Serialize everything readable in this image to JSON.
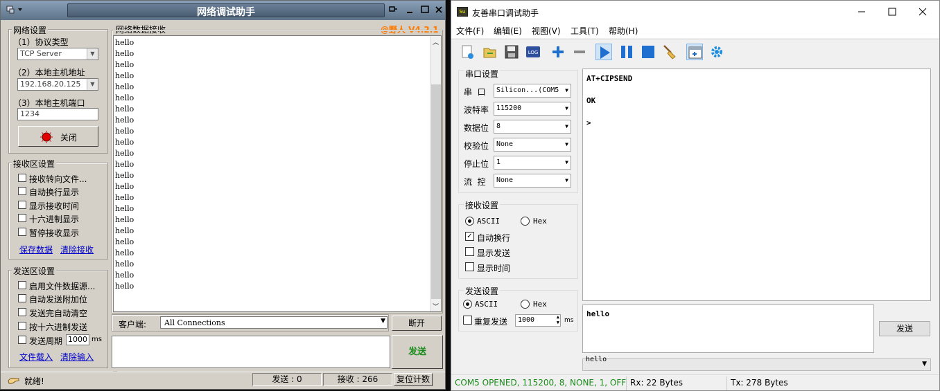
{
  "net": {
    "title": "网络调试助手",
    "version": "@野人 V4.2.1",
    "net_settings": {
      "group_label": "网络设置",
      "protocol_label": "（1）协议类型",
      "protocol_value": "TCP Server",
      "host_label": "（2）本地主机地址",
      "host_value": "192.168.20.125",
      "port_label": "（3）本地主机端口",
      "port_value": "1234",
      "close_button": "关闭"
    },
    "recv_settings": {
      "group_label": "接收区设置",
      "options": [
        "接收转向文件...",
        "自动换行显示",
        "显示接收时间",
        "十六进制显示",
        "暂停接收显示"
      ],
      "save_link": "保存数据",
      "clear_link": "清除接收"
    },
    "send_settings": {
      "group_label": "发送区设置",
      "options": [
        "启用文件数据源...",
        "自动发送附加位",
        "发送完自动清空",
        "按十六进制发送"
      ],
      "period_label": "发送周期",
      "period_value": "1000",
      "period_unit": "ms",
      "load_link": "文件载入",
      "clear_link": "清除输入"
    },
    "recv_area_label": "网络数据接收",
    "recv_lines": [
      "hello",
      "hello",
      "hello",
      "hello",
      "hello",
      "hello",
      "hello",
      "hello",
      "hello",
      "hello",
      "hello",
      "hello",
      "hello",
      "hello",
      "hello",
      "hello",
      "hello",
      "hello",
      "hello",
      "hello",
      "hello",
      "hello",
      "hello"
    ],
    "client_label": "客户端:",
    "client_value": "All Connections",
    "disconnect_button": "断开",
    "send_button": "发送",
    "status": {
      "ready": "就绪!",
      "sent": "发送 : 0",
      "received": "接收 : 266",
      "reset": "复位计数"
    }
  },
  "serial": {
    "title": "友善串口调试助手",
    "menu": [
      "文件(F)",
      "编辑(E)",
      "视图(V)",
      "工具(T)",
      "帮助(H)"
    ],
    "port_settings": {
      "group_label": "串口设置",
      "rows": [
        {
          "label": "串  口",
          "value": "Silicon...(COM5"
        },
        {
          "label": "波特率",
          "value": "115200"
        },
        {
          "label": "数据位",
          "value": "8"
        },
        {
          "label": "校验位",
          "value": "None"
        },
        {
          "label": "停止位",
          "value": "1"
        },
        {
          "label": "流  控",
          "value": "None"
        }
      ]
    },
    "recv_settings": {
      "group_label": "接收设置",
      "ascii": "ASCII",
      "hex": "Hex",
      "options": [
        {
          "label": "自动换行",
          "checked": true
        },
        {
          "label": "显示发送",
          "checked": false
        },
        {
          "label": "显示时间",
          "checked": false
        }
      ]
    },
    "send_settings": {
      "group_label": "发送设置",
      "ascii": "ASCII",
      "hex": "Hex",
      "repeat_label": "重复发送",
      "repeat_value": "1000",
      "unit": "ms"
    },
    "recv_lines": [
      "AT+CIPSEND",
      "",
      "OK",
      "",
      ">"
    ],
    "send_text": "hello",
    "send_button": "发送",
    "history_value": "hello",
    "status": {
      "port": "COM5 OPENED, 115200, 8, NONE, 1, OFF",
      "rx": "Rx: 22 Bytes",
      "tx": "Tx: 278 Bytes"
    },
    "colors": {
      "status_green": "#1a8a1a",
      "play_blue": "#1e6fd0"
    }
  }
}
